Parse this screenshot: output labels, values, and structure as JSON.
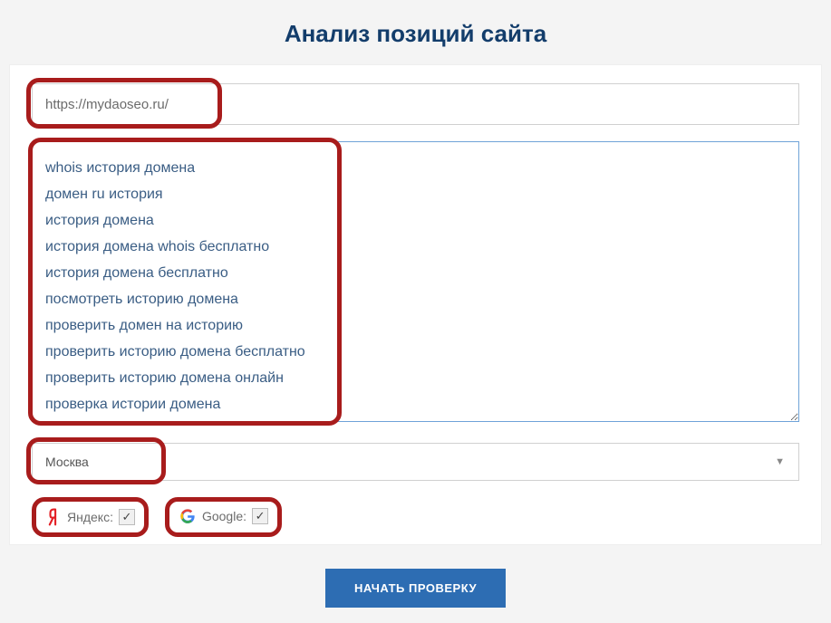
{
  "title": "Анализ позиций сайта",
  "url_value": "https://mydaoseo.ru/",
  "keywords_value": "whois история домена\nдомен ru история\nистория домена\nистория домена whois бесплатно\nистория домена бесплатно\nпосмотреть историю домена\nпроверить домен на историю\nпроверить историю домена бесплатно\nпроверить историю домена онлайн\nпроверка истории домена",
  "region_value": "Москва",
  "engines": {
    "yandex": {
      "label": "Яндекс:",
      "checked": true
    },
    "google": {
      "label": "Google:",
      "checked": true
    }
  },
  "submit_label": "НАЧАТЬ ПРОВЕРКУ"
}
